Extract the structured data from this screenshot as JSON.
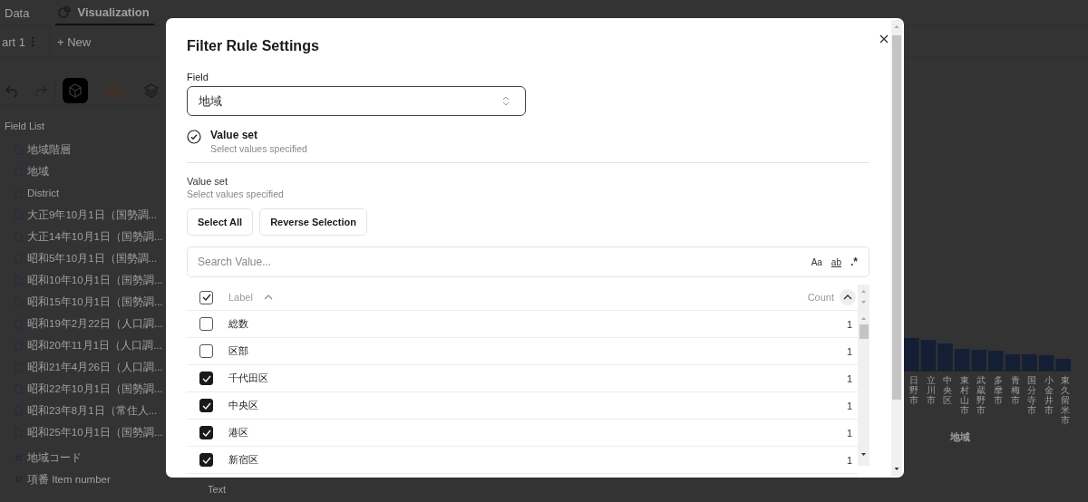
{
  "top_tabs": [
    {
      "label": "Data",
      "selected": false,
      "kind": "plain"
    },
    {
      "label": "Visualization",
      "selected": true,
      "kind": "chart"
    }
  ],
  "chart_tabs": {
    "current": "art 1",
    "new_label": "+ New"
  },
  "toolbar": [
    {
      "kind": "cube",
      "selected": true
    },
    {
      "kind": "frame",
      "selected": false
    },
    {
      "kind": "layers",
      "selected": false
    }
  ],
  "field_list": {
    "title": "Field List",
    "items": [
      {
        "name": "地域階層",
        "kind": "text"
      },
      {
        "name": "地域",
        "kind": "text"
      },
      {
        "name": "District",
        "kind": "text"
      },
      {
        "name": "大正9年10月1日（国勢調...",
        "kind": "text"
      },
      {
        "name": "大正14年10月1日（国勢調...",
        "kind": "text"
      },
      {
        "name": "昭和5年10月1日（国勢調...",
        "kind": "text"
      },
      {
        "name": "昭和10年10月1日（国勢調...",
        "kind": "text"
      },
      {
        "name": "昭和15年10月1日（国勢調...",
        "kind": "text"
      },
      {
        "name": "昭和19年2月22日（人口調...",
        "kind": "text"
      },
      {
        "name": "昭和20年11月1日（人口調...",
        "kind": "text"
      },
      {
        "name": "昭和21年4月26日（人口調...",
        "kind": "text"
      },
      {
        "name": "昭和22年10月1日（国勢調...",
        "kind": "text"
      },
      {
        "name": "昭和23年8月1日（常住人...",
        "kind": "text"
      },
      {
        "name": "昭和25年10月1日（国勢調...",
        "kind": "text"
      }
    ],
    "measures": [
      {
        "name": "地域コード",
        "kind": "number"
      },
      {
        "name": "項番 Item number",
        "kind": "number"
      }
    ]
  },
  "background_label": "Text",
  "chart": {
    "axis_labels": [
      "日野市",
      "立川市",
      "中央区",
      "東村山市",
      "武蔵野市",
      "多摩市",
      "青梅市",
      "国分寺市",
      "小金井市",
      "東久留米市"
    ],
    "axis_title": "地域"
  },
  "modal": {
    "title": "Filter Rule Settings",
    "field_label": "Field",
    "field_value": "地域",
    "rule": {
      "title": "Value set",
      "subtitle": "Select values specified",
      "selected": true
    },
    "section_title": "Value set",
    "section_subtitle": "Select values specified",
    "buttons": [
      "Select All",
      "Reverse Selection"
    ],
    "search": {
      "placeholder": "Search Value...",
      "options": [
        {
          "label": "Aa",
          "kind": "case"
        },
        {
          "label": "ab",
          "kind": "word"
        },
        {
          "label": ".*",
          "kind": "regex"
        }
      ]
    },
    "table": {
      "header_checked": true,
      "label_header": "Label",
      "count_header": "Count",
      "rows": [
        {
          "label": "総数",
          "count": "1",
          "checked": false
        },
        {
          "label": "区部",
          "count": "1",
          "checked": false
        },
        {
          "label": "千代田区",
          "count": "1",
          "checked": true
        },
        {
          "label": "中央区",
          "count": "1",
          "checked": true
        },
        {
          "label": "港区",
          "count": "1",
          "checked": true
        },
        {
          "label": "新宿区",
          "count": "1",
          "checked": true
        }
      ]
    }
  }
}
